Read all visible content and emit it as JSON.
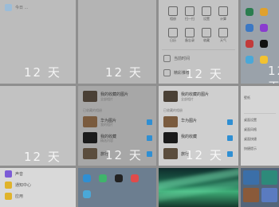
{
  "overlay": {
    "days_label": "12 天"
  },
  "top_left_note": "今日 ...",
  "control_center": {
    "tiles": [
      "相册",
      "扫一扫",
      "设置",
      "计算",
      "日历",
      "备忘录",
      "收藏",
      "天气",
      "图库",
      "笔记",
      "录音",
      "手电"
    ],
    "rows": [
      "当前时间",
      "精彩推荐"
    ]
  },
  "gallery_card": {
    "title": "我的收藏的图片",
    "subtitle": "全部相片"
  },
  "list_section": {
    "header": "已收藏的相册",
    "items": [
      {
        "title": "华为图片",
        "sub": "我的相片"
      },
      {
        "title": "我的收藏",
        "sub": "精选内容"
      },
      {
        "title": "旅行",
        "sub": "相片"
      }
    ]
  },
  "settings_rows": [
    "声音",
    "通知中心",
    "应用"
  ],
  "right_panel": [
    "壁纸",
    "桌面设置",
    "桌面风格",
    "桌面快捷",
    "快捷提示"
  ],
  "colors": {
    "accent": "#2f8fd3",
    "bg": "#8f8f8f"
  }
}
